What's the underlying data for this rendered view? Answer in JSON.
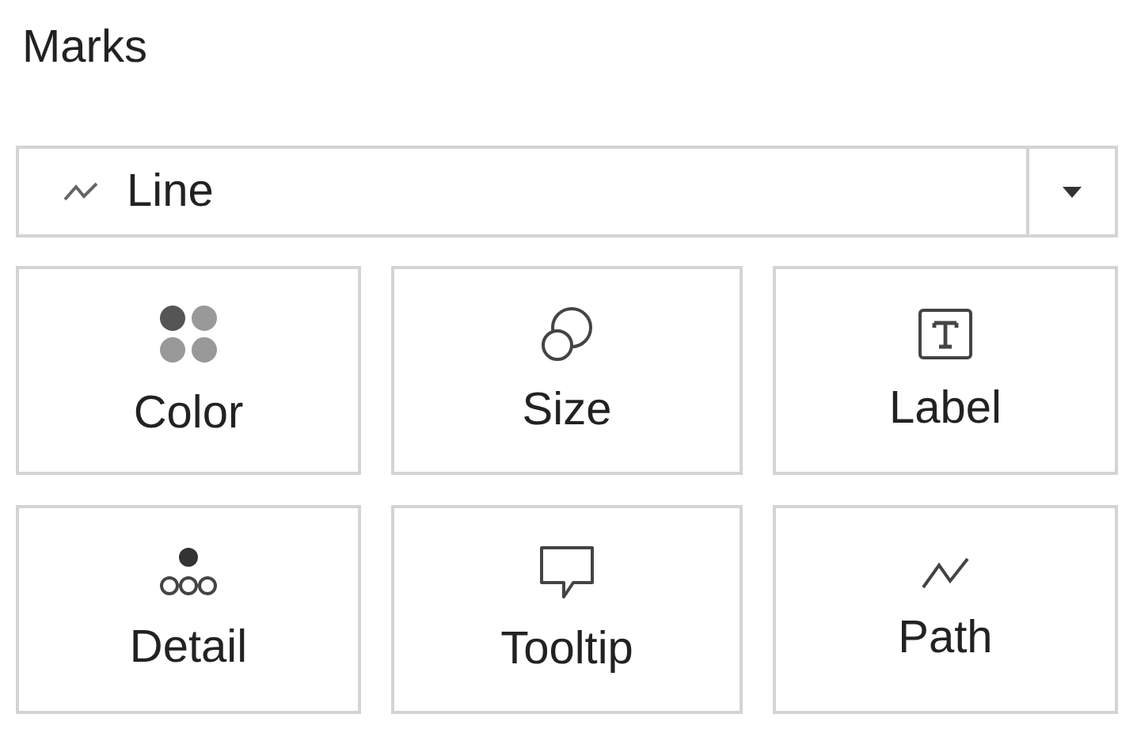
{
  "title": "Marks",
  "mark_type": {
    "value": "Line",
    "kind": "line"
  },
  "cards": [
    {
      "label": "Color",
      "kind": "color"
    },
    {
      "label": "Size",
      "kind": "size"
    },
    {
      "label": "Label",
      "kind": "label"
    },
    {
      "label": "Detail",
      "kind": "detail"
    },
    {
      "label": "Tooltip",
      "kind": "tooltip"
    },
    {
      "label": "Path",
      "kind": "path"
    }
  ]
}
